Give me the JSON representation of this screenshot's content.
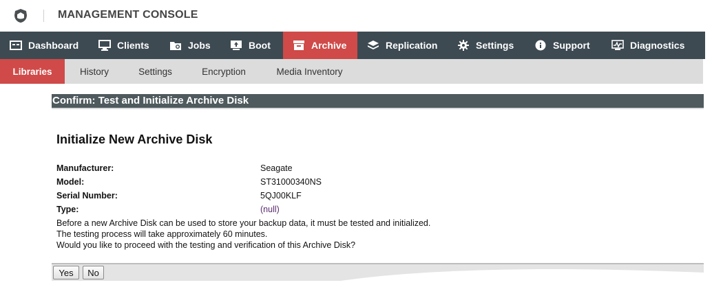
{
  "app": {
    "title": "MANAGEMENT CONSOLE"
  },
  "main_nav": [
    {
      "label": "Dashboard",
      "icon": "dashboard-icon",
      "active": false
    },
    {
      "label": "Clients",
      "icon": "monitor-icon",
      "active": false
    },
    {
      "label": "Jobs",
      "icon": "jobs-icon",
      "active": false
    },
    {
      "label": "Boot",
      "icon": "boot-icon",
      "active": false
    },
    {
      "label": "Archive",
      "icon": "archive-icon",
      "active": true
    },
    {
      "label": "Replication",
      "icon": "layers-icon",
      "active": false
    },
    {
      "label": "Settings",
      "icon": "gear-icon",
      "active": false
    },
    {
      "label": "Support",
      "icon": "info-icon",
      "active": false
    },
    {
      "label": "Diagnostics",
      "icon": "diagnostics-icon",
      "active": false
    }
  ],
  "sub_nav": [
    {
      "label": "Libraries",
      "active": true
    },
    {
      "label": "History",
      "active": false
    },
    {
      "label": "Settings",
      "active": false
    },
    {
      "label": "Encryption",
      "active": false
    },
    {
      "label": "Media Inventory",
      "active": false
    }
  ],
  "panel": {
    "header": "Confirm: Test and Initialize Archive Disk",
    "title": "Initialize New Archive Disk",
    "properties": [
      {
        "label": "Manufacturer:",
        "value": "Seagate"
      },
      {
        "label": "Model:",
        "value": "ST31000340NS"
      },
      {
        "label": "Serial Number:",
        "value": "5QJ00KLF"
      },
      {
        "label": "Type:",
        "value": "(null)"
      }
    ],
    "messages": [
      "Before a new Archive Disk can be used to store your backup data, it must be tested and initialized.",
      "The testing process will take approximately 60 minutes.",
      "Would you like to proceed with the testing and verification of this Archive Disk?"
    ],
    "buttons": {
      "yes": "Yes",
      "no": "No"
    }
  },
  "colors": {
    "nav_bg": "#3d4a52",
    "accent": "#cf4a48",
    "subnav_bg": "#dcdcdc",
    "panel_header": "#4f5a5e"
  }
}
